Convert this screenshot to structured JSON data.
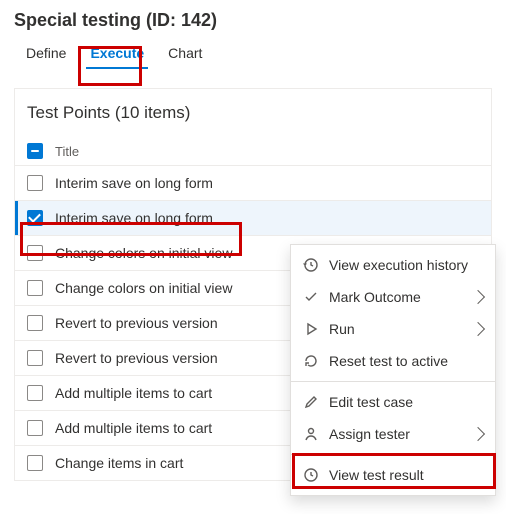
{
  "header": {
    "title": "Special testing (ID: 142)"
  },
  "tabs": {
    "define": "Define",
    "execute": "Execute",
    "chart": "Chart",
    "active": "execute"
  },
  "panel": {
    "title": "Test Points (10 items)",
    "column_header": "Title",
    "rows": [
      {
        "title": "Interim save on long form",
        "checked": false
      },
      {
        "title": "Interim save on long form",
        "checked": true
      },
      {
        "title": "Change colors on initial view",
        "checked": false
      },
      {
        "title": "Change colors on initial view",
        "checked": false
      },
      {
        "title": "Revert to previous version",
        "checked": false
      },
      {
        "title": "Revert to previous version",
        "checked": false
      },
      {
        "title": "Add multiple items to cart",
        "checked": false
      },
      {
        "title": "Add multiple items to cart",
        "checked": false
      },
      {
        "title": "Change items in cart",
        "checked": false
      }
    ]
  },
  "context_menu": {
    "history": "View execution history",
    "mark_outcome": "Mark Outcome",
    "run": "Run",
    "reset": "Reset test to active",
    "edit": "Edit test case",
    "assign": "Assign tester",
    "view_result": "View test result"
  }
}
